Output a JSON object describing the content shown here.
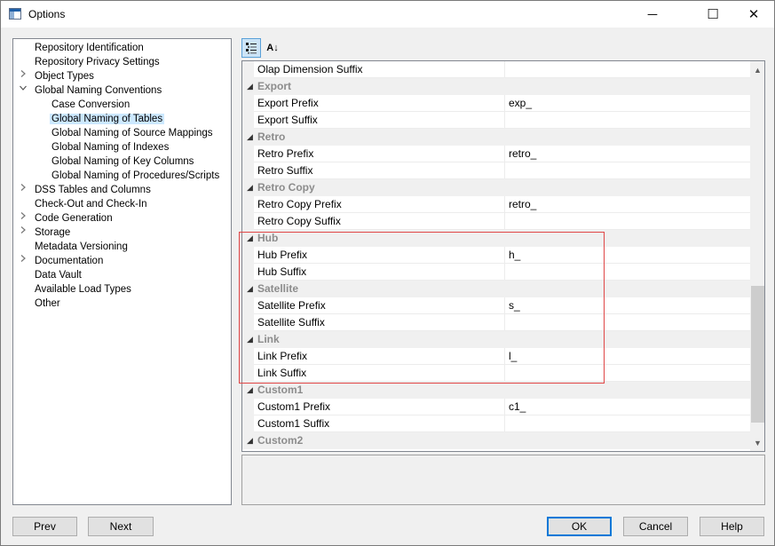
{
  "window": {
    "title": "Options",
    "minimize_glyph": "─",
    "maximize_glyph": "☐",
    "close_glyph": "✕"
  },
  "tree": {
    "items": [
      {
        "label": "Repository Identification",
        "level": 0,
        "expander": "none"
      },
      {
        "label": "Repository Privacy Settings",
        "level": 0,
        "expander": "none"
      },
      {
        "label": "Object Types",
        "level": 0,
        "expander": "collapsed"
      },
      {
        "label": "Global Naming Conventions",
        "level": 0,
        "expander": "expanded"
      },
      {
        "label": "Case Conversion",
        "level": 1,
        "expander": "none"
      },
      {
        "label": "Global Naming of Tables",
        "level": 1,
        "expander": "none",
        "selected": true
      },
      {
        "label": "Global Naming of Source Mappings",
        "level": 1,
        "expander": "none"
      },
      {
        "label": "Global Naming of Indexes",
        "level": 1,
        "expander": "none"
      },
      {
        "label": "Global Naming of Key Columns",
        "level": 1,
        "expander": "none"
      },
      {
        "label": "Global Naming of Procedures/Scripts",
        "level": 1,
        "expander": "none"
      },
      {
        "label": "DSS Tables and Columns",
        "level": 0,
        "expander": "collapsed"
      },
      {
        "label": "Check-Out and Check-In",
        "level": 0,
        "expander": "none"
      },
      {
        "label": "Code Generation",
        "level": 0,
        "expander": "collapsed"
      },
      {
        "label": "Storage",
        "level": 0,
        "expander": "collapsed"
      },
      {
        "label": "Metadata Versioning",
        "level": 0,
        "expander": "none"
      },
      {
        "label": "Documentation",
        "level": 0,
        "expander": "collapsed"
      },
      {
        "label": "Data Vault",
        "level": 0,
        "expander": "none"
      },
      {
        "label": "Available Load Types",
        "level": 0,
        "expander": "none"
      },
      {
        "label": "Other",
        "level": 0,
        "expander": "none"
      }
    ]
  },
  "toolbar": {
    "categorized_icon": "categorized-icon",
    "alphabetical_icon": "sort-az-icon",
    "alphabetical_glyph": "A↓"
  },
  "grid": {
    "rows": [
      {
        "kind": "prop",
        "name": "Olap Dimension Suffix",
        "value": ""
      },
      {
        "kind": "cat",
        "name": "Export"
      },
      {
        "kind": "prop",
        "name": "Export Prefix",
        "value": "exp_"
      },
      {
        "kind": "prop",
        "name": "Export Suffix",
        "value": ""
      },
      {
        "kind": "cat",
        "name": "Retro"
      },
      {
        "kind": "prop",
        "name": "Retro Prefix",
        "value": "retro_"
      },
      {
        "kind": "prop",
        "name": "Retro Suffix",
        "value": ""
      },
      {
        "kind": "cat",
        "name": "Retro Copy"
      },
      {
        "kind": "prop",
        "name": "Retro Copy Prefix",
        "value": "retro_"
      },
      {
        "kind": "prop",
        "name": "Retro Copy Suffix",
        "value": ""
      },
      {
        "kind": "cat",
        "name": "Hub"
      },
      {
        "kind": "prop",
        "name": "Hub Prefix",
        "value": "h_"
      },
      {
        "kind": "prop",
        "name": "Hub Suffix",
        "value": ""
      },
      {
        "kind": "cat",
        "name": "Satellite"
      },
      {
        "kind": "prop",
        "name": "Satellite Prefix",
        "value": "s_"
      },
      {
        "kind": "prop",
        "name": "Satellite Suffix",
        "value": ""
      },
      {
        "kind": "cat",
        "name": "Link"
      },
      {
        "kind": "prop",
        "name": "Link Prefix",
        "value": "l_"
      },
      {
        "kind": "prop",
        "name": "Link Suffix",
        "value": ""
      },
      {
        "kind": "cat",
        "name": "Custom1"
      },
      {
        "kind": "prop",
        "name": "Custom1 Prefix",
        "value": "c1_"
      },
      {
        "kind": "prop",
        "name": "Custom1 Suffix",
        "value": ""
      },
      {
        "kind": "cat",
        "name": "Custom2"
      }
    ],
    "scroll_up_glyph": "▲",
    "scroll_down_glyph": "▼",
    "collapse_glyph": "◢"
  },
  "buttons": {
    "prev": "Prev",
    "next": "Next",
    "ok": "OK",
    "cancel": "Cancel",
    "help": "Help"
  },
  "colors": {
    "selection": "#cce8ff",
    "highlight_box": "#e04646",
    "default_button_border": "#0078d7"
  }
}
